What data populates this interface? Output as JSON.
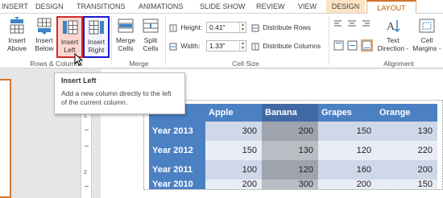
{
  "tabs": [
    {
      "label": "INSERT"
    },
    {
      "label": "DESIGN"
    },
    {
      "label": "TRANSITIONS"
    },
    {
      "label": "ANIMATIONS"
    },
    {
      "label": "SLIDE SHOW"
    },
    {
      "label": "REVIEW"
    },
    {
      "label": "VIEW"
    },
    {
      "label": "DESIGN"
    },
    {
      "label": "LAYOUT"
    }
  ],
  "ribbon": {
    "rows_columns": {
      "label": "Rows & Columns",
      "insert_above": {
        "line1": "Insert",
        "line2": "Above"
      },
      "insert_below": {
        "line1": "Insert",
        "line2": "Below"
      },
      "insert_left": {
        "line1": "Insert",
        "line2": "Left"
      },
      "insert_right": {
        "line1": "Insert",
        "line2": "Right"
      }
    },
    "merge": {
      "label": "Merge",
      "merge_cells": {
        "line1": "Merge",
        "line2": "Cells"
      },
      "split_cells": {
        "line1": "Split",
        "line2": "Cells"
      }
    },
    "cell_size": {
      "label": "Cell Size",
      "height_label": "Height:",
      "height_value": "0.41\"",
      "width_label": "Width:",
      "width_value": "1.33\"",
      "distribute_rows": "Distribute Rows",
      "distribute_columns": "Distribute Columns"
    },
    "alignment": {
      "label": "Alignment",
      "text_direction": {
        "line1": "Text",
        "line2": "Direction -"
      },
      "cell_margins": {
        "line1": "Cell",
        "line2": "Margins -"
      }
    }
  },
  "tooltip": {
    "title": "Insert Left",
    "description": "Add a new column directly to the left of the current column."
  },
  "ruler": {
    "numbers": [
      "1",
      "2"
    ]
  },
  "table": {
    "columns": [
      "",
      "Apple",
      "Banana",
      "Grapes",
      "Orange"
    ],
    "rows": [
      {
        "label": "Year 2013",
        "values": [
          "300",
          "200",
          "150",
          "130"
        ]
      },
      {
        "label": "Year 2012",
        "values": [
          "150",
          "130",
          "120",
          "220"
        ]
      },
      {
        "label": "Year 2011",
        "values": [
          "100",
          "120",
          "160",
          "200"
        ]
      },
      {
        "label": "Year 2010",
        "values": [
          "200",
          "300",
          "200",
          "150"
        ]
      }
    ]
  },
  "colors": {
    "accent_orange": "#d0722a",
    "table_header_blue": "#4b80c3",
    "selection_red": "#d42a2a",
    "selection_blue": "#1a1ad0"
  }
}
